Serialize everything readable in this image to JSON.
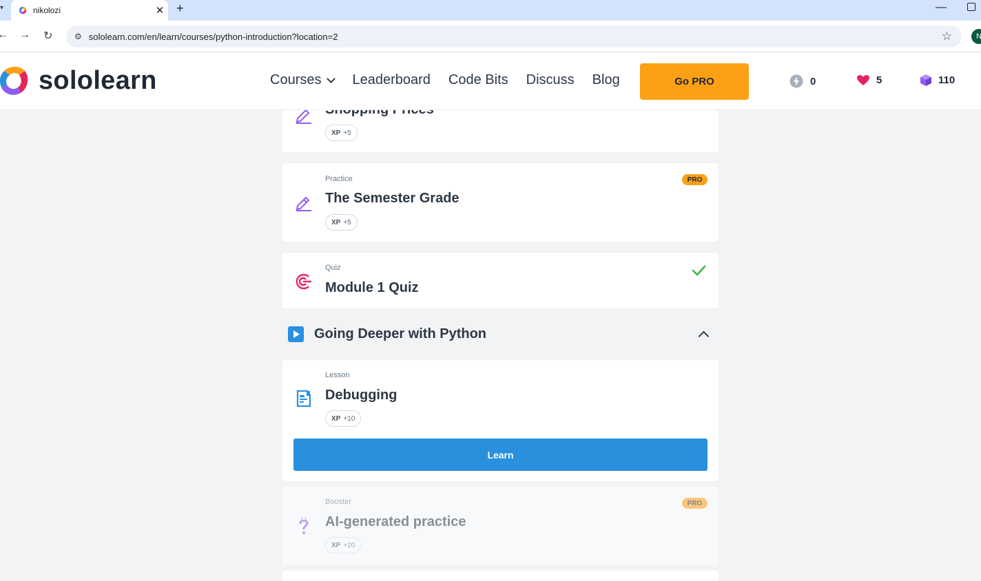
{
  "browser": {
    "tab_title": "nikolozi",
    "url": "sololearn.com/en/learn/courses/python-introduction?location=2",
    "profile_initial": "N"
  },
  "header": {
    "logo_text": "sololearn",
    "nav": [
      "Courses",
      "Leaderboard",
      "Code Bits",
      "Discuss",
      "Blog"
    ],
    "go_pro": "Go PRO",
    "stats": {
      "streak": "0",
      "hearts": "5",
      "gems": "110"
    }
  },
  "lessons": [
    {
      "type": "",
      "title": "Shopping Prices",
      "xp_label": "XP",
      "xp": "+5",
      "icon": "practice-pencil-icon"
    },
    {
      "type": "Practice",
      "title": "The Semester Grade",
      "xp_label": "XP",
      "xp": "+5",
      "badge": "PRO",
      "icon": "practice-pencil-icon"
    },
    {
      "type": "Quiz",
      "title": "Module 1 Quiz",
      "completed": true,
      "icon": "quiz-target-icon"
    }
  ],
  "section": {
    "title": "Going Deeper with Python",
    "expanded": true
  },
  "section_items": [
    {
      "type": "Lesson",
      "title": "Debugging",
      "xp_label": "XP",
      "xp": "+10",
      "button": "Learn",
      "icon": "lesson-document-icon"
    },
    {
      "type": "Booster",
      "title": "AI-generated practice",
      "xp_label": "XP",
      "xp": "+20",
      "badge": "PRO",
      "icon": "booster-question-icon",
      "locked": true
    }
  ],
  "colors": {
    "accent_orange": "#fca015",
    "accent_blue": "#2890dd",
    "pencil_purple": "#8e5cf0",
    "quiz_red": "#e5245e",
    "check_green": "#3fb44c"
  }
}
